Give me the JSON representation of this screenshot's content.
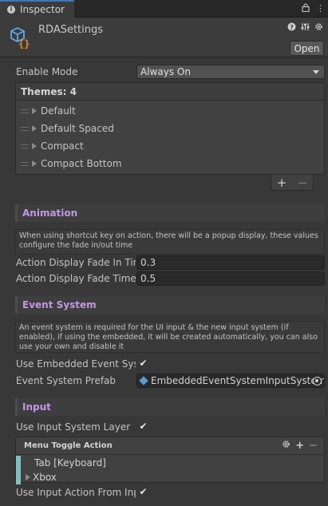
{
  "tab": {
    "label": "Inspector"
  },
  "header": {
    "title": "RDASettings",
    "open_label": "Open"
  },
  "enable_mode": {
    "label": "Enable Mode",
    "value": "Always On"
  },
  "themes": {
    "header": "Themes: 4",
    "items": [
      {
        "label": "Default"
      },
      {
        "label": "Default Spaced"
      },
      {
        "label": "Compact"
      },
      {
        "label": "Compact Bottom"
      }
    ],
    "add_label": "+",
    "remove_label": "−"
  },
  "animation": {
    "title": "Animation",
    "help": "When using shortcut key on action, there will be a popup display, these values configure the fade in/out time",
    "fade_in": {
      "label": "Action Display Fade In Tim",
      "value": "0.3"
    },
    "fade_time": {
      "label": "Action Display Fade Time",
      "value": "0.5"
    }
  },
  "event_system": {
    "title": "Event System",
    "help": "An event system is required for the UI input & the new input system (if enabled), if using the embedded, it will be created automatically, you can also use your own and disable it",
    "use_embedded": {
      "label": "Use Embedded Event Syste",
      "checked": true
    },
    "prefab": {
      "label": "Event System Prefab",
      "value": "EmbeddedEventSystemInputSystem"
    }
  },
  "input": {
    "title": "Input",
    "use_input_layer": {
      "label": "Use Input System Layer",
      "checked": true
    },
    "menu_toggle": {
      "header": "Menu Toggle Action",
      "items": [
        {
          "label": "Tab [Keyboard]"
        },
        {
          "label": "Xbox"
        }
      ]
    },
    "use_action_from_input": {
      "label": "Use Input Action From Inpu",
      "checked": true
    }
  },
  "colors": {
    "section_title": "#c495e9",
    "accent_tab": "#3a79bb",
    "action_bar": "#84bfbf"
  }
}
